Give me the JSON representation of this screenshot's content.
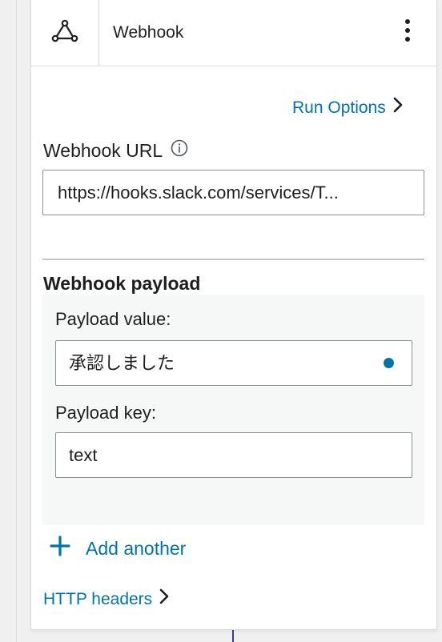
{
  "header": {
    "title": "Webhook",
    "icon": "webhook-icon",
    "menu_icon": "more-vertical-icon"
  },
  "run_options": {
    "label": "Run Options",
    "icon": "chevron-right-icon"
  },
  "webhook_url": {
    "label": "Webhook URL",
    "info_icon": "info-icon",
    "value": "https://hooks.slack.com/services/T..."
  },
  "payload": {
    "title": "Webhook payload",
    "value_label": "Payload value:",
    "value": "承認しました",
    "key_label": "Payload key:",
    "key": "text"
  },
  "add_another": {
    "label": "Add another",
    "icon": "plus-icon"
  },
  "http_headers": {
    "label": "HTTP headers",
    "icon": "chevron-right-icon"
  },
  "colors": {
    "accent": "#0073aa",
    "border": "#dcdcde",
    "panel_bg": "#ffffff",
    "page_bg": "#f0f0f1",
    "payload_bg": "#f6f7f7"
  }
}
